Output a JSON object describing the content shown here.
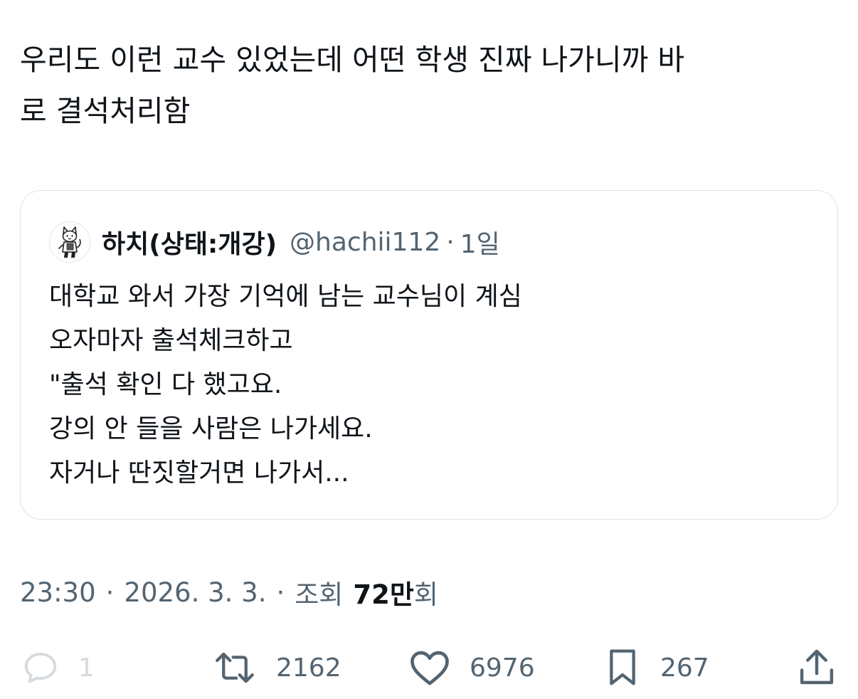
{
  "tweet": {
    "text": "우리도 이런 교수 있었는데 어떤 학생 진짜 나가니까 바\n로 결석처리함"
  },
  "quote": {
    "display_name": "하치(상태:개강)",
    "handle": "@hachii112",
    "separator": "·",
    "time_ago": "1일",
    "avatar_icon": "cat-character-avatar",
    "body": "대학교 와서 가장 기억에 남는 교수님이 계심\n오자마자 출석체크하고\n\"출석 확인 다 했고요.\n강의 안 들을 사람은 나가세요.\n자거나 딴짓할거면 나가서..."
  },
  "meta": {
    "time": "23:30",
    "separator": "·",
    "date": "2026. 3. 3.",
    "views_label": "조회",
    "views_number": "72만",
    "views_suffix": "회"
  },
  "actions": {
    "reply": {
      "icon": "reply-icon",
      "count": "1"
    },
    "retweet": {
      "icon": "retweet-icon",
      "count": "2162"
    },
    "like": {
      "icon": "heart-icon",
      "count": "6976"
    },
    "bookmark": {
      "icon": "bookmark-icon",
      "count": "267"
    },
    "share": {
      "icon": "share-icon"
    }
  },
  "colors": {
    "text_primary": "#0f1419",
    "text_secondary": "#536471",
    "border": "#dfe3e7",
    "disabled": "#d5dade",
    "background": "#ffffff"
  }
}
